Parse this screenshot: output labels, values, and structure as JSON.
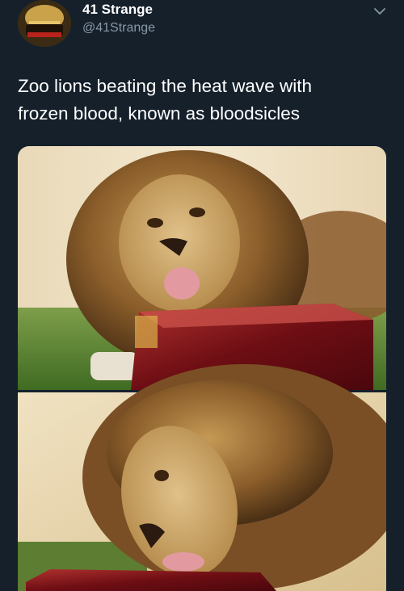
{
  "author": {
    "display_name": "41 Strange",
    "handle": "@41Strange"
  },
  "tweet": {
    "text_line1": "Zoo lions beating the heat wave with",
    "text_line2": "frozen blood, known as bloodsicles"
  },
  "colors": {
    "background": "#15202b",
    "secondary_text": "#8899a6",
    "primary_text": "#ffffff"
  },
  "icons": {
    "menu": "chevron-down-icon"
  }
}
